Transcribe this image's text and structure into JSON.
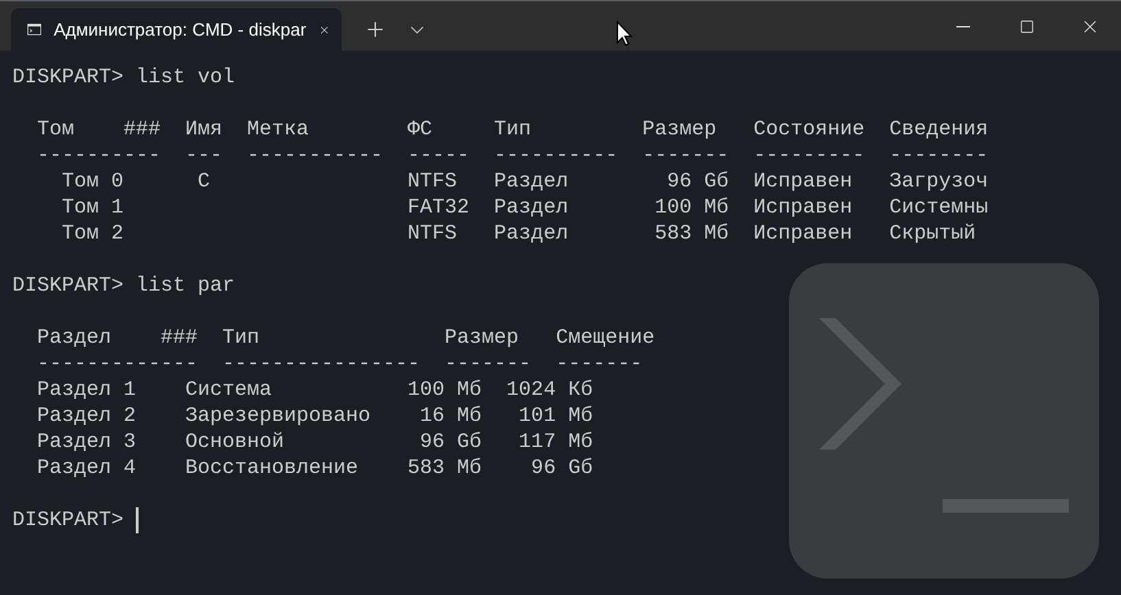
{
  "tab": {
    "title": "Администратор: CMD - diskpar",
    "selected": true
  },
  "output": [
    {
      "kind": "command",
      "text": "DISKPART> list vol"
    },
    {
      "kind": "table",
      "lines": [
        "  Том    ###  Имя  Метка        ФС     Тип         Размер   Состояние  Сведения",
        "  ----------  ---  -----------  -----  ----------  -------  ---------  --------",
        "    Том 0      C                NTFS   Раздел        96 Gб  Исправен   Загрузоч",
        "    Том 1                       FAT32  Раздел       100 Мб  Исправен   Системны",
        "    Том 2                       NTFS   Раздел       583 Мб  Исправен   Скрытый"
      ]
    },
    {
      "kind": "command",
      "text": "DISKPART> list par"
    },
    {
      "kind": "table",
      "lines": [
        "  Раздел    ###  Тип               Размер   Смещение",
        "  -------------  ----------------  -------  -------",
        "  Раздел 1    Система           100 Мб  1024 Кб",
        "  Раздел 2    Зарезервировано    16 Мб   101 Мб",
        "  Раздел 3    Основной           96 Gб   117 Мб",
        "  Раздел 4    Восстановление    583 Мб    96 Gб"
      ]
    },
    {
      "kind": "prompt",
      "text": "DISKPART>",
      "cursor": true
    }
  ]
}
